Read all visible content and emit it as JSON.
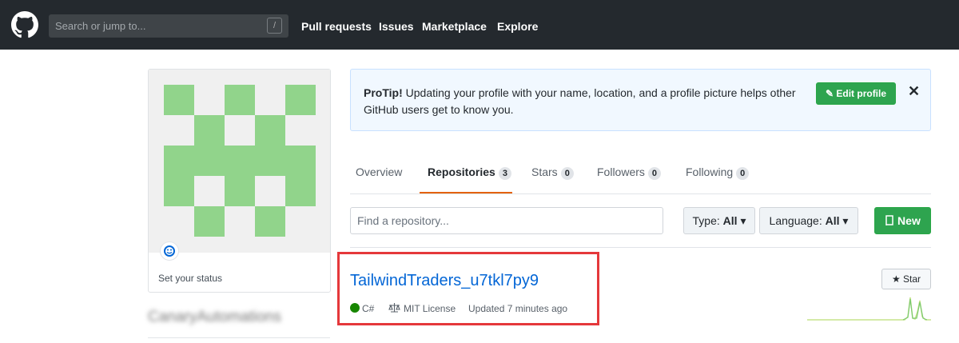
{
  "header": {
    "search_placeholder": "Search or jump to...",
    "slash_hint": "/",
    "nav": [
      "Pull requests",
      "Issues",
      "Marketplace",
      "Explore"
    ]
  },
  "sidebar": {
    "status_label": "Set your status",
    "blurred_username": "CanaryAutomations"
  },
  "protip": {
    "lead": "ProTip!",
    "text": " Updating your profile with your name, location, and a profile picture helps other GitHub users get to know you.",
    "button_label": "Edit profile",
    "close_glyph": "✕"
  },
  "tabs": [
    {
      "label": "Overview",
      "count": null
    },
    {
      "label": "Repositories",
      "count": "3"
    },
    {
      "label": "Stars",
      "count": "0"
    },
    {
      "label": "Followers",
      "count": "0"
    },
    {
      "label": "Following",
      "count": "0"
    }
  ],
  "filters": {
    "search_placeholder": "Find a repository...",
    "type_label": "Type:",
    "type_value": "All",
    "language_label": "Language:",
    "language_value": "All",
    "new_label": "New"
  },
  "repo": {
    "name": "TailwindTraders_u7tkl7py9",
    "language": "C#",
    "license": "MIT License",
    "updated": "Updated 7 minutes ago",
    "star_label": "Star"
  },
  "colors": {
    "header_bg": "#24292e",
    "accent_green": "#2ea44f",
    "link_blue": "#0366d6",
    "tab_underline": "#e36209",
    "csharp": "#178600",
    "highlight_red": "#e5383b",
    "identicon": "#91d48b"
  }
}
